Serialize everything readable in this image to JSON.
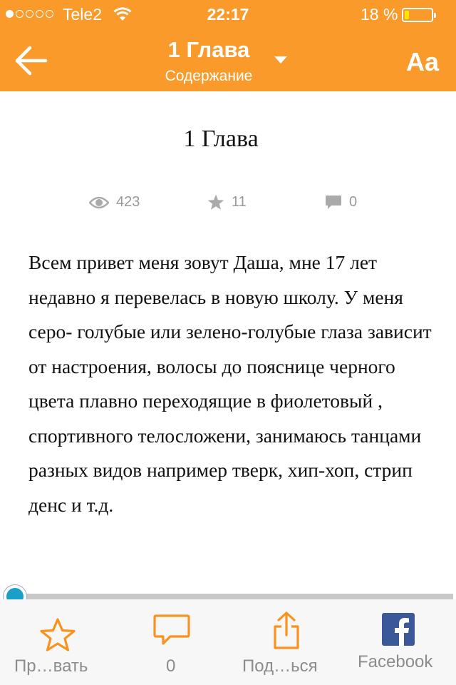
{
  "status_bar": {
    "signal_filled": 1,
    "signal_total": 5,
    "carrier": "Tele2",
    "time": "22:17",
    "battery_percent": "18 %",
    "battery_level": 0.18
  },
  "header": {
    "title": "1 Глава",
    "subtitle": "Содержание",
    "back_icon": "arrow-left-icon",
    "dropdown_icon": "caret-down-icon",
    "font_button_label": "Aa"
  },
  "chapter": {
    "title": "1 Глава",
    "stats": {
      "views": "423",
      "stars": "11",
      "comments": "0"
    },
    "text": "Всем привет меня зовут Даша, мне 17 лет недавно я перевелась в новую школу. У меня серо- голубые или зелено-голубые глаза  зависит от настроения, волосы до пояснице черного цвета плавно переходящие в фиолетовый , спортивного телосложени, занимаюсь танцами разных видов например тверк, хип-хоп, стрип денс и т.д."
  },
  "reading_progress": 0.0,
  "toolbar": {
    "vote_label": "Пр…вать",
    "comments_count": "0",
    "share_label": "Под…ься",
    "facebook_label": "Facebook"
  },
  "colors": {
    "accent": "#f99a2a",
    "icon_orange": "#f7931e",
    "slider_knob": "#1aa0c8",
    "facebook_blue": "#3b5998",
    "muted_gray": "#999999"
  }
}
